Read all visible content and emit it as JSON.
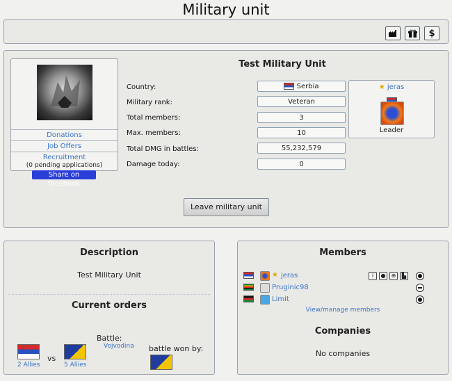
{
  "page": {
    "title": "Military unit"
  },
  "toolbar": {
    "icons": [
      "factory-icon",
      "gift-icon",
      "dollar-icon"
    ],
    "dollar_label": "$"
  },
  "unit": {
    "name": "Test Military Unit",
    "links": {
      "donations": "Donations",
      "job_offers": "Job Offers",
      "recruitment": "Recruitment",
      "pending": "(0 pending applications)"
    },
    "share": "Share on facebook",
    "fields": {
      "country_label": "Country:",
      "country_value": "Serbia",
      "rank_label": "Military rank:",
      "rank_value": "Veteran",
      "total_members_label": "Total members:",
      "total_members_value": "3",
      "max_members_label": "Max. members:",
      "max_members_value": "10",
      "total_dmg_label": "Total DMG in battles:",
      "total_dmg_value": "55,232,579",
      "damage_today_label": "Damage today:",
      "damage_today_value": "0"
    },
    "leader": {
      "name": "jeras",
      "role": "Leader"
    },
    "leave_button": "Leave military unit"
  },
  "description": {
    "heading": "Description",
    "text": "Test Military Unit",
    "orders_heading": "Current orders",
    "battle_label": "Battle:",
    "battle_name": "Vojvodina",
    "won_by_label": "battle won by:",
    "left_allies": "2 Allies",
    "vs": "vs",
    "right_allies": "5 Allies"
  },
  "members": {
    "heading": "Members",
    "list": [
      {
        "name": "jeras",
        "flag": "serbia"
      },
      {
        "name": "Pruginic98",
        "flag": "zimbabwe"
      },
      {
        "name": "Limit",
        "flag": "malawi"
      }
    ],
    "manage_link": "View/manage members",
    "companies_heading": "Companies",
    "companies_text": "No companies"
  }
}
